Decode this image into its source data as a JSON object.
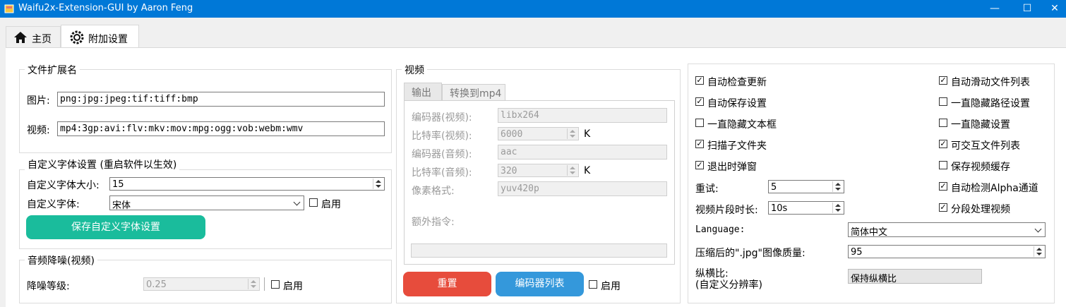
{
  "window": {
    "title": "Waifu2x-Extension-GUI by Aaron Feng"
  },
  "tabs": [
    {
      "label": "主页"
    },
    {
      "label": "附加设置"
    }
  ],
  "file_ext": {
    "title": "文件扩展名",
    "image_label": "图片:",
    "image_value": "png:jpg:jpeg:tif:tiff:bmp",
    "video_label": "视频:",
    "video_value": "mp4:3gp:avi:flv:mkv:mov:mpg:ogg:vob:webm:wmv"
  },
  "font": {
    "title": "自定义字体设置 (重启软件以生效)",
    "size_label": "自定义字体大小:",
    "size_value": "15",
    "font_label": "自定义字体:",
    "font_value": "宋体",
    "enable_label": "启用",
    "save_button": "保存自定义字体设置"
  },
  "audio": {
    "title": "音频降噪(视频)",
    "level_label": "降噪等级:",
    "level_value": "0.25",
    "enable_label": "启用"
  },
  "video": {
    "title": "视频",
    "tabs": [
      {
        "label": "输出"
      },
      {
        "label": "转换到mp4"
      }
    ],
    "encoder_video_label": "编码器(视频):",
    "encoder_video_value": "libx264",
    "bitrate_video_label": "比特率(视频):",
    "bitrate_video_value": "6000",
    "bitrate_video_unit": "K",
    "encoder_audio_label": "编码器(音频):",
    "encoder_audio_value": "aac",
    "bitrate_audio_label": "比特率(音频):",
    "bitrate_audio_value": "320",
    "bitrate_audio_unit": "K",
    "pixel_format_label": "像素格式:",
    "pixel_format_value": "yuv420p",
    "extra_cmd_label": "额外指令:",
    "extra_cmd_value": "",
    "reset_button": "重置",
    "encoder_list_button": "编码器列表",
    "enable_label": "启用"
  },
  "settings": {
    "checkboxes_left": [
      {
        "label": "自动检查更新",
        "checked": true
      },
      {
        "label": "自动保存设置",
        "checked": true
      },
      {
        "label": "一直隐藏文本框",
        "checked": false
      },
      {
        "label": "扫描子文件夹",
        "checked": true
      },
      {
        "label": "退出时弹窗",
        "checked": true
      }
    ],
    "checkboxes_right": [
      {
        "label": "自动滑动文件列表",
        "checked": true
      },
      {
        "label": "一直隐藏路径设置",
        "checked": false
      },
      {
        "label": "一直隐藏设置",
        "checked": false
      },
      {
        "label": "可交互文件列表",
        "checked": true
      },
      {
        "label": "保存视频缓存",
        "checked": false
      },
      {
        "label": "自动检测Alpha通道",
        "checked": true
      },
      {
        "label": "分段处理视频",
        "checked": true
      }
    ],
    "retry_label": "重试:",
    "retry_value": "5",
    "segment_label": "视频片段时长:",
    "segment_value": "10s",
    "language_label": "Language:",
    "language_value": "简体中文",
    "jpg_quality_label": "压缩后的\".jpg\"图像质量:",
    "jpg_quality_value": "95",
    "aspect_label_1": "纵横比:",
    "aspect_label_2": "(自定义分辨率)",
    "aspect_value": "保持纵横比"
  },
  "colors": {
    "titlebar": "#0078d7",
    "save_button": "#1abc9c",
    "reset_button": "#e74c3c",
    "encoder_button": "#3498db"
  }
}
